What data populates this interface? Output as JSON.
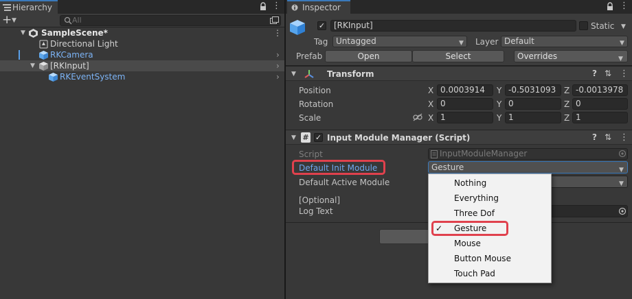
{
  "hierarchy": {
    "tab_label": "Hierarchy",
    "add_label": "+",
    "search_placeholder": "All",
    "scene_label": "SampleScene*",
    "items": [
      {
        "label": "Directional Light"
      },
      {
        "label": "RKCamera"
      },
      {
        "label": "[RKInput]"
      },
      {
        "label": "RKEventSystem"
      }
    ]
  },
  "inspector": {
    "tab_label": "Inspector",
    "object_name": "[RKInput]",
    "static_label": "Static",
    "tag_label": "Tag",
    "tag_value": "Untagged",
    "layer_label": "Layer",
    "layer_value": "Default",
    "prefab_label": "Prefab",
    "open_label": "Open",
    "select_label": "Select",
    "overrides_label": "Overrides",
    "transform": {
      "title": "Transform",
      "position_label": "Position",
      "rotation_label": "Rotation",
      "scale_label": "Scale",
      "axes": [
        "X",
        "Y",
        "Z"
      ],
      "position": [
        "0.0003914",
        "-0.5031093",
        "-0.0013978"
      ],
      "rotation": [
        "0",
        "0",
        "0"
      ],
      "scale": [
        "1",
        "1",
        "1"
      ]
    },
    "module_manager": {
      "title": "Input Module Manager (Script)",
      "script_label": "Script",
      "script_value": "InputModuleManager",
      "default_init_label": "Default Init Module",
      "default_init_value": "Gesture",
      "default_active_label": "Default Active Module",
      "optional_label": "[Optional]",
      "log_text_label": "Log Text"
    }
  },
  "dropdown": {
    "options": [
      "Nothing",
      "Everything",
      "Three Dof",
      "Gesture",
      "Mouse",
      "Button Mouse",
      "Touch Pad"
    ],
    "selected": "Gesture",
    "check_mark": "✓"
  },
  "colors": {
    "highlight": "#e0414d",
    "accent_blue": "#7cb3f5",
    "selection_row": "#4a4a4a"
  }
}
